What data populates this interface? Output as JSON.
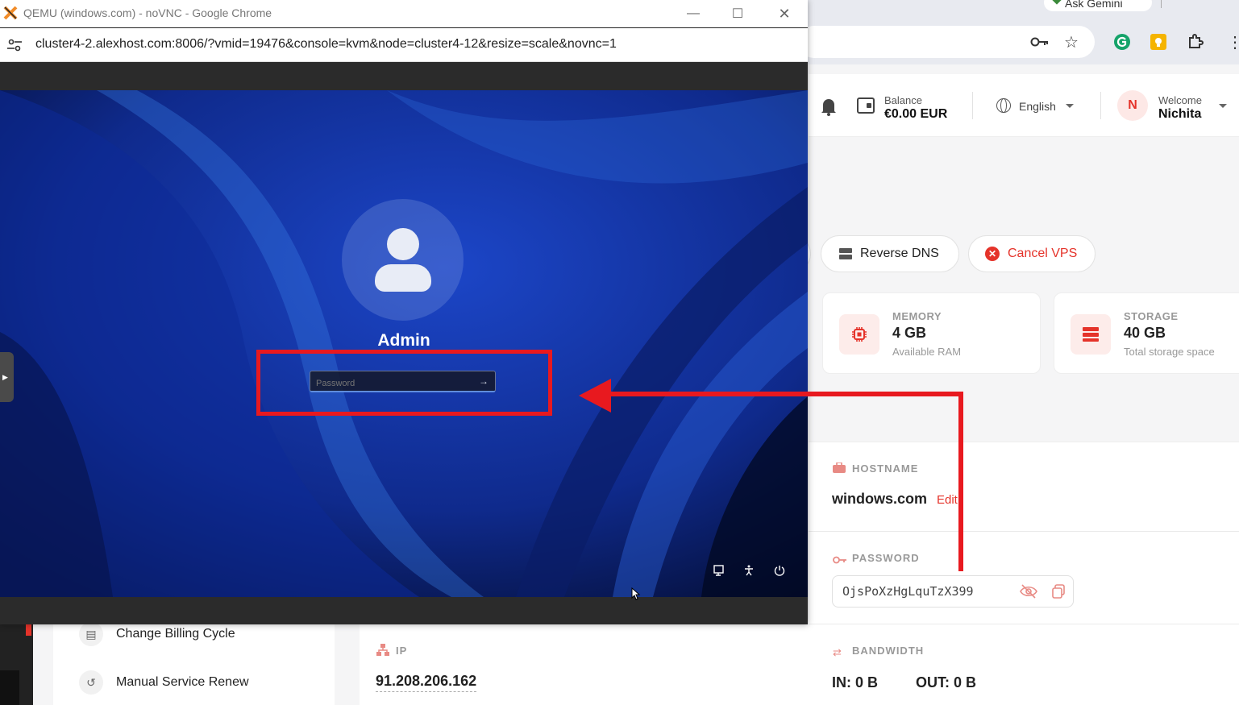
{
  "browser_bg": {
    "gemini_tab": "Ask Gemini"
  },
  "header": {
    "balance_label": "Balance",
    "balance_value": "€0.00 EUR",
    "language": "English",
    "welcome_label": "Welcome",
    "user_name": "Nichita",
    "avatar_initial": "N"
  },
  "actions": {
    "reverse_dns": "Reverse DNS",
    "cancel_vps": "Cancel VPS"
  },
  "specs": [
    {
      "label": "MEMORY",
      "value": "4 GB",
      "sub": "Available RAM"
    },
    {
      "label": "STORAGE",
      "value": "40 GB",
      "sub": "Total storage space"
    }
  ],
  "info": {
    "hostname_label": "HOSTNAME",
    "hostname_value": "windows.com",
    "edit_label": "Edit",
    "password_label": "PASSWORD",
    "password_value": "OjsPoXzHgLquTzX399",
    "bandwidth_label": "BANDWIDTH",
    "bandwidth_in": "IN: 0 B",
    "bandwidth_out": "OUT: 0 B",
    "ip_label": "IP",
    "ip_value": "91.208.206.162"
  },
  "menu": {
    "change_billing": "Change Billing Cycle",
    "manual_renew": "Manual Service Renew"
  },
  "popup": {
    "title": "QEMU (windows.com) - noVNC - Google Chrome",
    "url": "cluster4-2.alexhost.com:8006/?vmid=19476&console=kvm&node=cluster4-12&resize=scale&novnc=1"
  },
  "vnc": {
    "user_name": "Admin",
    "password_placeholder": "Password"
  },
  "colors": {
    "accent_red": "#e5332a",
    "annotation_red": "#e8191f"
  }
}
